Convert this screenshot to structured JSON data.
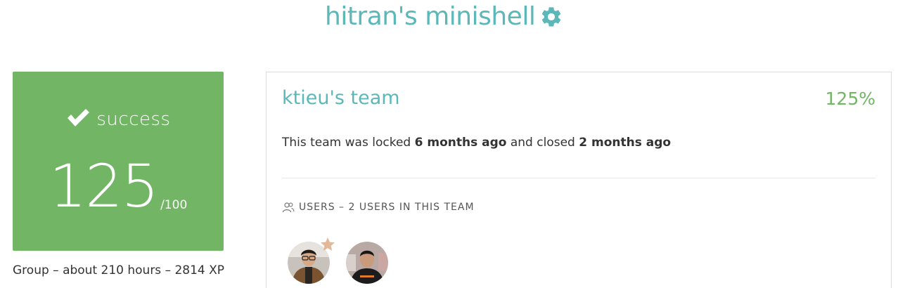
{
  "header": {
    "project_title": "hitran's minishell",
    "settings_icon": "gear-icon"
  },
  "grade": {
    "status_icon": "check-icon",
    "status": "success",
    "score": "125",
    "max": "/100",
    "colors": {
      "box": "#71b565",
      "text": "#ffffff"
    }
  },
  "project_meta": "Group – about 210 hours – 2814 XP",
  "team": {
    "name": "ktieu's team",
    "percent": "125%",
    "status_prefix": "This team was locked",
    "locked_ago": "6 months ago",
    "status_middle": "and closed",
    "closed_ago": "2 months ago",
    "users_icon": "users-icon",
    "users_heading": "Users – 2 users in this team",
    "members": [
      {
        "avatar": "avatar",
        "leader": true,
        "leader_icon": "star-icon"
      },
      {
        "avatar": "avatar",
        "leader": false
      }
    ]
  },
  "colors": {
    "accent_teal": "#5bb7b8",
    "success_green": "#71b565",
    "leader_star": "#e2b898"
  }
}
